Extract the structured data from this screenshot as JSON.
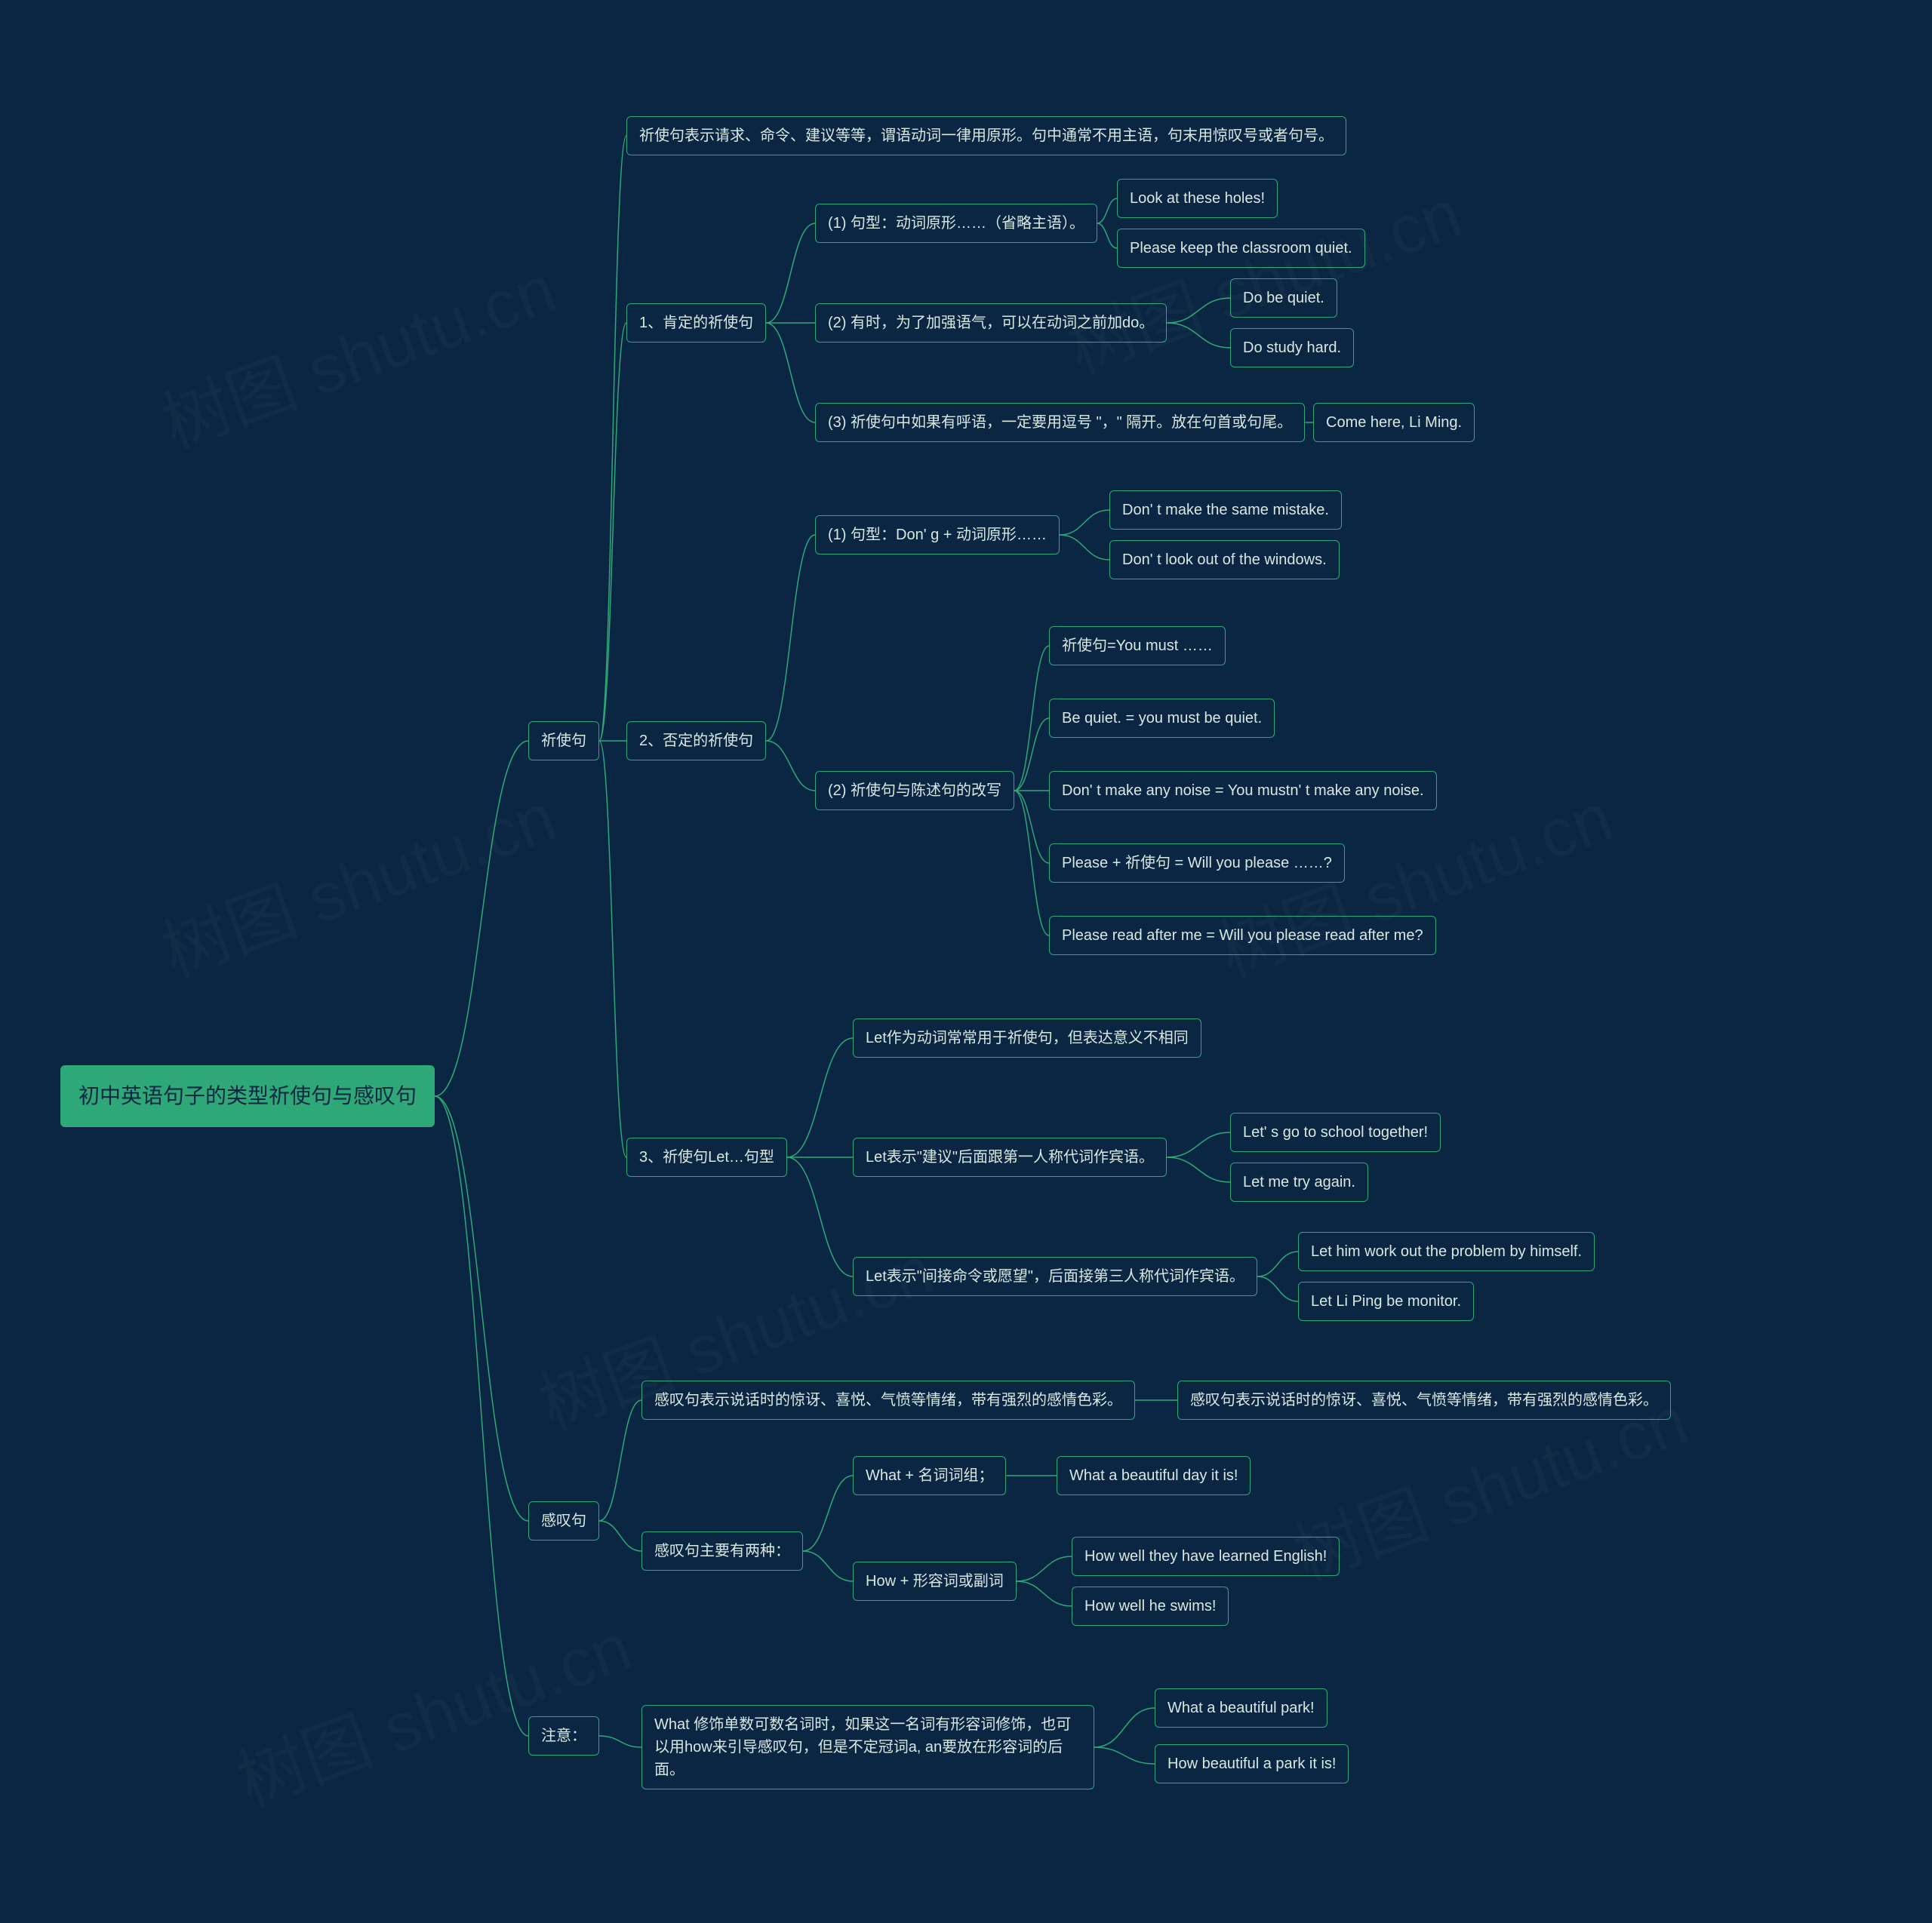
{
  "root": "初中英语句子的类型祈使句与感叹句",
  "b1": "祈使句",
  "b2": "感叹句",
  "b3": "注意：",
  "c_intro": "祈使句表示请求、命令、建议等等，谓语动词一律用原形。句中通常不用主语，句末用惊叹号或者句号。",
  "c1": "1、肯定的祈使句",
  "c1_1": "(1) 句型：动词原形……（省略主语）。",
  "c1_1a": "Look at these holes!",
  "c1_1b": "Please keep the classroom quiet.",
  "c1_2": "(2) 有时，为了加强语气，可以在动词之前加do。",
  "c1_2a": "Do be quiet.",
  "c1_2b": "Do study hard.",
  "c1_3": "(3) 祈使句中如果有呼语，一定要用逗号 \"，\" 隔开。放在句首或句尾。",
  "c1_3a": "Come here, Li Ming.",
  "c2": "2、否定的祈使句",
  "c2_1": "(1) 句型：Don' g + 动词原形……",
  "c2_1a": "Don' t make the same mistake.",
  "c2_1b": "Don' t look out of the windows.",
  "c2_2": "(2) 祈使句与陈述句的改写",
  "c2_2a": "祈使句=You must ……",
  "c2_2b": "Be quiet. = you must be quiet.",
  "c2_2c": "Don' t make any noise = You mustn' t make any noise.",
  "c2_2d": "Please + 祈使句 = Will you please ……?",
  "c2_2e": "Please read after me = Will you please read after me?",
  "c3": "3、祈使句Let…句型",
  "c3_1": "Let作为动词常常用于祈使句，但表达意义不相同",
  "c3_2": "Let表示\"建议\"后面跟第一人称代词作宾语。",
  "c3_2a": "Let' s go to school together!",
  "c3_2b": "Let me try again.",
  "c3_3": "Let表示\"间接命令或愿望\"，后面接第三人称代词作宾语。",
  "c3_3a": "Let him work out the problem by himself.",
  "c3_3b": "Let Li Ping be monitor.",
  "d1": "感叹句表示说话时的惊讶、喜悦、气愤等情绪，带有强烈的感情色彩。",
  "d1r": "感叹句表示说话时的惊讶、喜悦、气愤等情绪，带有强烈的感情色彩。",
  "d2": "感叹句主要有两种：",
  "d2_1": "What + 名词词组；",
  "d2_1a": "What a beautiful day it is!",
  "d2_2": "How + 形容词或副词",
  "d2_2a": "How well they have learned English!",
  "d2_2b": "How well he swims!",
  "e1": "What 修饰单数可数名词时，如果这一名词有形容词修饰，也可以用how来引导感叹句，但是不定冠词a, an要放在形容词的后面。",
  "e1a": "What a beautiful park!",
  "e1b": "How beautiful a park it is!",
  "watermark": "树图 shutu.cn"
}
